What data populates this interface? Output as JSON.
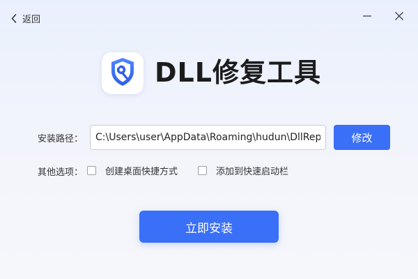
{
  "header": {
    "back_label": "返回"
  },
  "window_controls": {
    "minimize_icon": "minimize-icon",
    "close_icon": "close-icon"
  },
  "app": {
    "logo_icon": "shield-wrench-icon",
    "title": "DLL修复工具"
  },
  "install_path": {
    "label": "安装路径：",
    "value": "C:\\Users\\user\\AppData\\Roaming\\hudun\\DllRep",
    "modify_label": "修改"
  },
  "options": {
    "label": "其他选项：",
    "items": [
      {
        "label": "创建桌面快捷方式",
        "checked": false
      },
      {
        "label": "添加到快速启动栏",
        "checked": false
      }
    ]
  },
  "install_button": {
    "label": "立即安装"
  },
  "colors": {
    "accent": "#3a6ff7",
    "background_top": "#e9f0fd",
    "background_bottom": "#f6f7fb"
  }
}
